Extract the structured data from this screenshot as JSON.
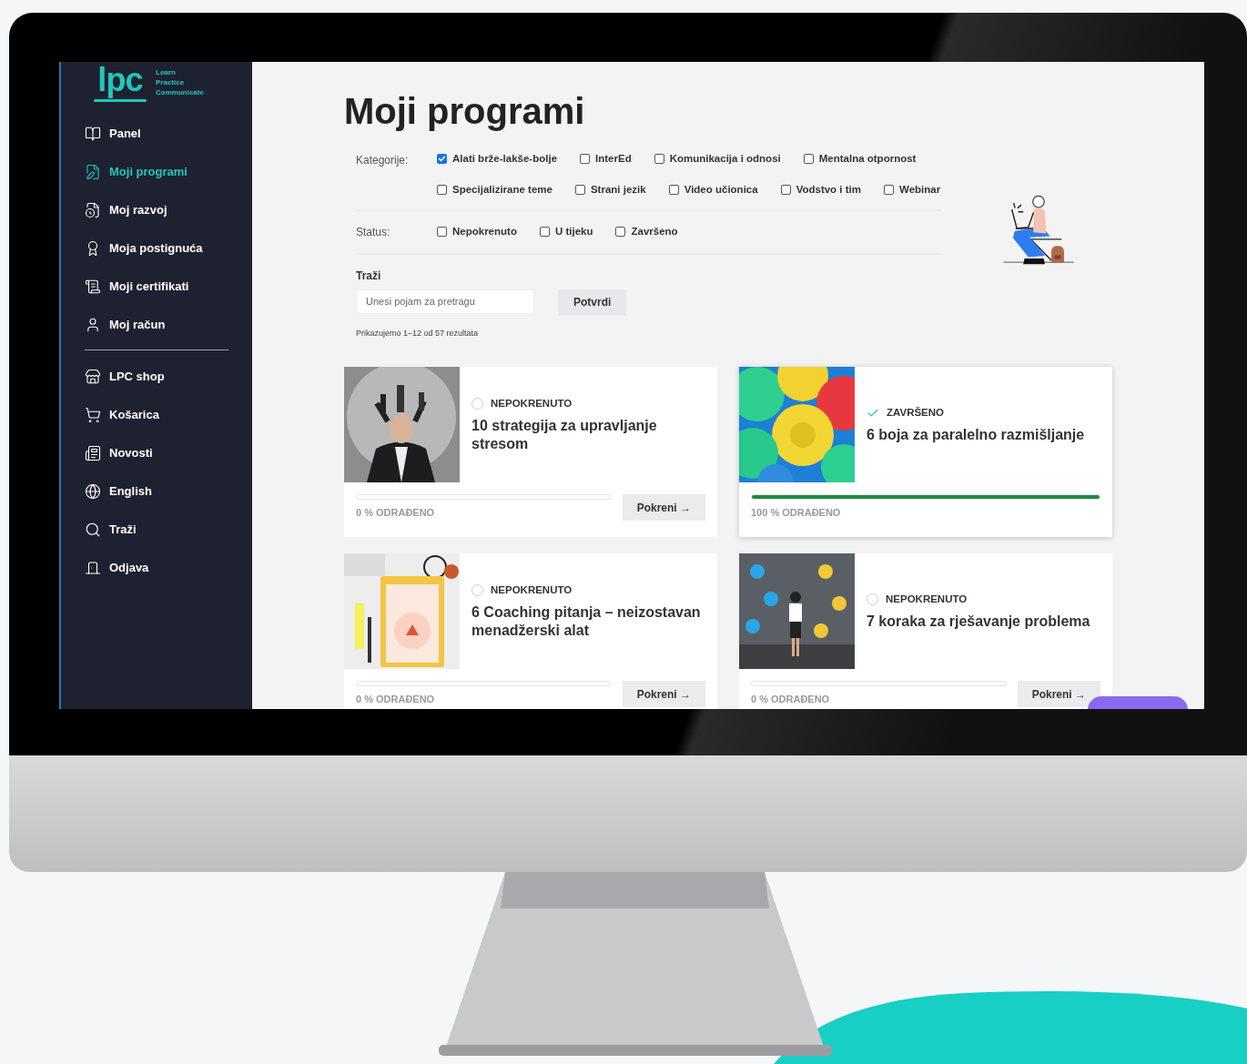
{
  "sidebar": {
    "logo": {
      "mark": "lpc",
      "tagline": [
        "Learn",
        "Practice",
        "Communicate"
      ]
    },
    "primary_items": [
      {
        "label": "Panel",
        "selected": false
      },
      {
        "label": "Moji programi",
        "selected": true
      },
      {
        "label": "Moj razvoj",
        "selected": false
      },
      {
        "label": "Moja postignuća",
        "selected": false
      },
      {
        "label": "Moji certifikati",
        "selected": false
      },
      {
        "label": "Moj račun",
        "selected": false
      }
    ],
    "secondary_items": [
      {
        "label": "LPC shop",
        "selected": false
      },
      {
        "label": "Košarica",
        "selected": false
      },
      {
        "label": "Novosti",
        "selected": false
      },
      {
        "label": "English",
        "selected": false
      },
      {
        "label": "Traži",
        "selected": false
      },
      {
        "label": "Odjava",
        "selected": false
      }
    ]
  },
  "page_title": "Moji programi",
  "filters": {
    "categories": {
      "label": "Kategorije:",
      "options": [
        {
          "label": "Alati brže-lakše-bolje",
          "checked": true
        },
        {
          "label": "InterEd",
          "checked": false
        },
        {
          "label": "Komunikacija i odnosi",
          "checked": false
        },
        {
          "label": "Mentalna otpornost",
          "checked": false
        },
        {
          "label": "Specijalizirane teme",
          "checked": false
        },
        {
          "label": "Strani jezik",
          "checked": false
        },
        {
          "label": "Video učionica",
          "checked": false
        },
        {
          "label": "Vodstvo i tim",
          "checked": false
        },
        {
          "label": "Webinar",
          "checked": false
        }
      ]
    },
    "status": {
      "label": "Status:",
      "options": [
        {
          "label": "Nepokrenuto",
          "checked": false
        },
        {
          "label": "U tijeku",
          "checked": false
        },
        {
          "label": "Završeno",
          "checked": false
        }
      ]
    },
    "search": {
      "label": "Traži",
      "placeholder": "Unesi pojam za pretragu",
      "button": "Potvrdi"
    },
    "results": "Prikazujemo 1–12 od 57 rezultata"
  },
  "programs": [
    {
      "status": "NEPOKRENUTO",
      "completed": false,
      "title": "10 strategija za upravljanje stresom",
      "level": 0,
      "progress": "0 % ODRAĐENO",
      "button": "Pokreni →"
    },
    {
      "status": "ZAVRŠENO",
      "completed": true,
      "title": "6 boja za paralelno razmišljanje",
      "level": 1,
      "progress": "100 % ODRAĐENO"
    },
    {
      "status": "NEPOKRENUTO",
      "completed": false,
      "title": "6 Coaching pitanja – neizostavan menadžerski alat",
      "level": 0,
      "progress": "0 % ODRAĐENO",
      "button": "Pokreni →"
    },
    {
      "status": "NEPOKRENUTO",
      "completed": false,
      "title": "7 koraka za rješavanje problema",
      "level": 0,
      "progress": "0 % ODRAĐENO",
      "button": "Pokreni →"
    }
  ]
}
